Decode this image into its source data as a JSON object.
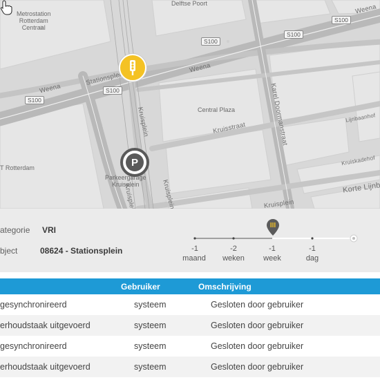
{
  "map": {
    "places": {
      "metrostation": "Metrostation\nRotterdam\nCentraal",
      "delftse_poort": "Delftse Poort",
      "central_plaza": "Central Plaza",
      "rotterdam": "T Rotterdam",
      "parkeergarage": "Parkeergarage\nKruisplein"
    },
    "roads": {
      "weena_left": "Weena",
      "stationsplein": "Stationsplein",
      "weena_right": "Weena",
      "karel_doormanstraat": "Karel Doormanstraat",
      "kruisstraat": "Kruisstraat",
      "kruisplein_1": "Kruisplein",
      "kruisplein_2": "Kruisplein",
      "kruisplein_3": "Kruisplein",
      "kruisplein_bottom": "Kruisplein",
      "lijnbaanhof": "Lijnbaanhof",
      "kruiskade": "Kruiskadehof",
      "korte_lijnbaan": "Korte Lijnb",
      "weena_top": "Weena"
    },
    "shields": [
      "S100",
      "S100",
      "S100",
      "S100",
      "S100",
      "S100"
    ],
    "marker_icon": "traffic-light-icon",
    "parking_icon": "parking-icon"
  },
  "filter": {
    "categorie_label": "ategorie",
    "categorie_value": "VRI",
    "object_label": "bject",
    "object_value": "08624 - Stationsplein"
  },
  "timeline": {
    "ticks": [
      {
        "num": "-1",
        "unit": "maand"
      },
      {
        "num": "-2",
        "unit": "weken"
      },
      {
        "num": "-1",
        "unit": "week"
      },
      {
        "num": "-1",
        "unit": "dag"
      }
    ],
    "selected_index": 2,
    "accent": "#1e9ad6"
  },
  "table": {
    "headers": {
      "col1": "",
      "gebruiker": "Gebruiker",
      "omschrijving": "Omschrijving"
    },
    "rows": [
      {
        "status": "gesynchronireerd",
        "gebruiker": "systeem",
        "omschrijving": "Gesloten door gebruiker"
      },
      {
        "status": "erhoudstaak uitgevoerd",
        "gebruiker": "systeem",
        "omschrijving": "Gesloten door gebruiker"
      },
      {
        "status": "gesynchronireerd",
        "gebruiker": "systeem",
        "omschrijving": "Gesloten door gebruiker"
      },
      {
        "status": "erhoudstaak uitgevoerd",
        "gebruiker": "systeem",
        "omschrijving": "Gesloten door gebruiker"
      }
    ]
  }
}
